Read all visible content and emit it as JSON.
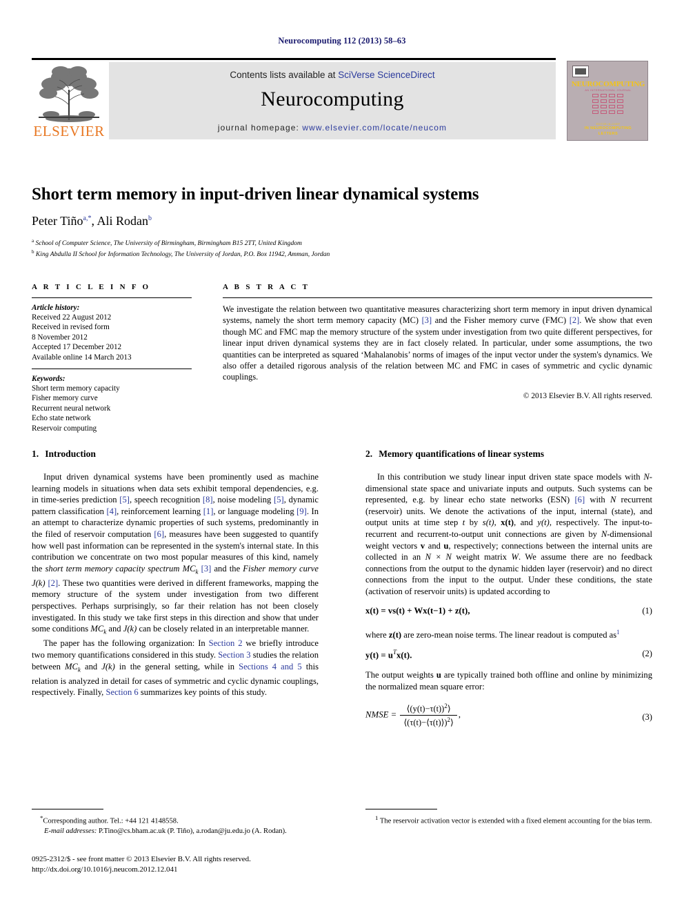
{
  "running_head": "Neurocomputing 112 (2013) 58–63",
  "masthead": {
    "contents_prefix": "Contents lists available at ",
    "contents_link": "SciVerse ScienceDirect",
    "journal_name": "Neurocomputing",
    "homepage_prefix": "journal homepage: ",
    "homepage_link": "www.elsevier.com/locate/neucom",
    "publisher_wordmark": "ELSEVIER",
    "cover": {
      "title": "NEUROCOMPUTING",
      "subtitle": "AN INTERNATIONAL JOURNAL",
      "footer_small": "EDITOR-IN-CHIEF",
      "footer_line1": "IN NEUROCOMPUTING",
      "footer_line2": "LETTERS"
    }
  },
  "title": "Short term memory in input-driven linear dynamical systems",
  "authors": {
    "a1_name": "Peter Tiño",
    "a1_marks": "a,*",
    "separator": ", ",
    "a2_name": "Ali Rodan",
    "a2_marks": "b"
  },
  "affiliations": [
    {
      "mark": "a",
      "text": "School of Computer Science, The University of Birmingham, Birmingham B15 2TT, United Kingdom"
    },
    {
      "mark": "b",
      "text": "King Abdulla II School for Information Technology, The University of Jordan, P.O. Box 11942, Amman, Jordan"
    }
  ],
  "article_info": {
    "heading": "A R T I C L E   I N F O",
    "history_label": "Article history:",
    "history": [
      "Received 22 August 2012",
      "Received in revised form",
      "8 November 2012",
      "Accepted 17 December 2012",
      "Available online 14 March 2013"
    ],
    "keywords_label": "Keywords:",
    "keywords": [
      "Short term memory capacity",
      "Fisher memory curve",
      "Recurrent neural network",
      "Echo state network",
      "Reservoir computing"
    ]
  },
  "abstract": {
    "heading": "A B S T R A C T",
    "p1_a": "We investigate the relation between two quantitative measures characterizing short term memory in input driven dynamical systems, namely the short term memory capacity (MC) ",
    "ref3": "[3]",
    "p1_b": " and the Fisher memory curve (FMC) ",
    "ref2": "[2]",
    "p1_c": ". We show that even though MC and FMC map the memory structure of the system under investigation from two quite different perspectives, for linear input driven dynamical systems they are in fact closely related. In particular, under some assumptions, the two quantities can be interpreted as squared ‘Mahalanobis’ norms of images of the input vector under the system's dynamics. We also offer a detailed rigorous analysis of the relation between MC and FMC in cases of symmetric and cyclic dynamic couplings.",
    "copyright": "© 2013 Elsevier B.V. All rights reserved."
  },
  "sections": {
    "s1": {
      "number": "1.",
      "title": "Introduction",
      "p1_a": "Input driven dynamical systems have been prominently used as machine learning models in situations when data sets exhibit temporal dependencies, e.g. in time-series prediction ",
      "r5a": "[5]",
      "p1_b": ", speech recognition ",
      "r8": "[8]",
      "p1_c": ", noise modeling ",
      "r5b": "[5]",
      "p1_d": ", dynamic pattern classification ",
      "r4": "[4]",
      "p1_e": ", reinforcement learning ",
      "r1": "[1]",
      "p1_f": ", or language modeling ",
      "r9": "[9]",
      "p1_g": ". In an attempt to characterize dynamic properties of such systems, predominantly in the filed of reservoir computation ",
      "r6": "[6]",
      "p1_h": ", measures have been suggested to quantify how well past information can be represented in the system's internal state. In this contribution we concentrate on two most popular measures of this kind, namely the ",
      "p1_i_italic1": "short term memory capacity spectrum MC",
      "p1_i_sub1": "k",
      "p1_j": " ",
      "r3": "[3]",
      "p1_k": " and the ",
      "p1_l_italic2": "Fisher memory curve J(k)",
      "p1_m": " ",
      "r2": "[2]",
      "p1_n": ". These two quantities were derived in different frameworks, mapping the memory structure of the system under investigation from two different perspectives. Perhaps surprisingly, so far their relation has not been closely investigated. In this study we take first steps in this direction and show that under some conditions ",
      "p1_o_italic3": "MC",
      "p1_o_sub": "k",
      "p1_p": " and ",
      "p1_q_italic4": "J(k)",
      "p1_r": " can be closely related in an interpretable manner.",
      "p2_a": "The paper has the following organization: In ",
      "lnk_s2": "Section 2",
      "p2_b": " we briefly introduce two memory quantifications considered in this study. ",
      "lnk_s3": "Section 3",
      "p2_c": " studies the relation between ",
      "p2_mc": "MC",
      "p2_mc_sub": "k",
      "p2_d": " and ",
      "p2_jk": "J(k)",
      "p2_e": " in the general setting, while in ",
      "lnk_s45": "Sections 4 and 5",
      "p2_f": " this relation is analyzed in detail for cases of symmetric and cyclic dynamic couplings, respectively. Finally, ",
      "lnk_s6": "Section 6",
      "p2_g": " summarizes key points of this study."
    },
    "s2": {
      "number": "2.",
      "title": "Memory quantifications of linear systems",
      "p1_a": "In this contribution we study linear input driven state space models with ",
      "p1_N1": "N",
      "p1_b": "-dimensional state space and univariate inputs and outputs. Such systems can be represented, e.g. by linear echo state networks (ESN) ",
      "r6": "[6]",
      "p1_c": " with ",
      "p1_N2": "N",
      "p1_d": " recurrent (reservoir) units. We denote the activations of the input, internal (state), and output units at time step ",
      "p1_t": "t",
      "p1_e": " by ",
      "p1_st": "s(t)",
      "p1_f": ", ",
      "p1_xt": "x(t)",
      "p1_g": ", and ",
      "p1_yt": "y(t)",
      "p1_h": ", respectively. The input-to-recurrent and recurrent-to-output unit connections are given by ",
      "p1_N3": "N",
      "p1_i": "-dimensional weight vectors ",
      "p1_v": "v",
      "p1_j": " and ",
      "p1_u": "u",
      "p1_k": ", respectively; connections between the internal units are collected in an ",
      "p1_NxN": "N × N",
      "p1_l": " weight matrix ",
      "p1_W": "W",
      "p1_m": ". We assume there are no feedback connections from the output to the dynamic hidden layer (reservoir) and no direct connections from the input to the output. Under these conditions, the state (activation of reservoir units) is updated according to",
      "eq1": "x(t) = vs(t) + Wx(t−1) + z(t),",
      "eq1_num": "(1)",
      "p2_a": "where ",
      "p2_zt": "z(t)",
      "p2_b": " are zero-mean noise terms. The linear readout is computed as",
      "p2_fn": "1",
      "eq2": "y(t) = u",
      "eq2_sup": "T",
      "eq2_rest": "x(t).",
      "eq2_num": "(2)",
      "p3_a": "The output weights ",
      "p3_u": "u",
      "p3_b": " are typically trained both offline and online by minimizing the normalized mean square error:",
      "eq3_lhs": "NMSE =",
      "eq3_num": "⟨(y(t)−τ(t))",
      "eq3_num_sup": "2",
      "eq3_num_end": "⟩",
      "eq3_den": "⟨(τ(t)−⟨τ(t)⟩)",
      "eq3_den_sup": "2",
      "eq3_den_end": "⟩",
      "eq3_comma": ",",
      "eq3_num_label": "(3)"
    }
  },
  "footnotes": {
    "left_mark": "*",
    "left_line1": "Corresponding author. Tel.: +44 121 4148558.",
    "left_email_label": "E-mail addresses:",
    "left_email_value": " P.Tino@cs.bham.ac.uk (P. Tiño), a.rodan@ju.edu.jo (A. Rodan).",
    "right_mark": "1",
    "right_text": "The reservoir activation vector is extended with a fixed element accounting for the bias term."
  },
  "imprint": {
    "line1": "0925-2312/$ - see front matter © 2013 Elsevier B.V. All rights reserved.",
    "line2": "http://dx.doi.org/10.1016/j.neucom.2012.12.041"
  },
  "colors": {
    "link": "#2b3a9c",
    "running_head": "#1a1a6e",
    "elsevier_orange": "#E87722",
    "masthead_bg": "#e3e3e3",
    "cover_bg": "#b9aeb2",
    "cover_yellow": "#f2c417"
  }
}
